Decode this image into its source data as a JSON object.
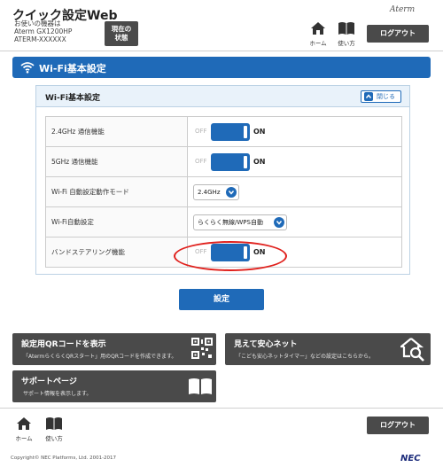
{
  "header": {
    "app_title": "クイック設定Web",
    "device_label": "お使いの機器は",
    "model": "Aterm GX1200HP",
    "serial": "ATERM-XXXXXX",
    "status_button": "現在の状態",
    "home": "ホーム",
    "manual": "使い方",
    "brand": "Aterm",
    "logout": "ログアウト"
  },
  "section": {
    "title": "Wi-Fi基本設定"
  },
  "panel": {
    "title": "Wi-Fi基本設定",
    "close_label": "閉じる",
    "rows": [
      {
        "label": "2.4GHz 通信機能",
        "off": "OFF",
        "on": "ON"
      },
      {
        "label": "5GHz 通信機能",
        "off": "OFF",
        "on": "ON"
      },
      {
        "label": "Wi-Fi 自動設定動作モード",
        "select": "2.4GHz"
      },
      {
        "label": "Wi-Fi自動設定",
        "select": "らくらく無線/WPS自動"
      },
      {
        "label": "バンドステアリング機能",
        "off": "OFF",
        "on": "ON"
      }
    ]
  },
  "apply_button": "設定",
  "cards": {
    "qr": {
      "title": "設定用QRコードを表示",
      "desc": "「AtermらくらくQRスタート」用のQRコードを作成できます。"
    },
    "safe": {
      "title": "見えて安心ネット",
      "desc": "「こども安心ネットタイマー」などの設定はこちらから。"
    },
    "support": {
      "title": "サポートページ",
      "desc": "サポート情報を表示します。"
    }
  },
  "footer": {
    "home": "ホーム",
    "manual": "使い方",
    "logout": "ログアウト",
    "copyright": "Copyright© NEC Platforms, Ltd. 2001-2017",
    "logo": "NEC"
  },
  "colors": {
    "accent": "#1f6ab8",
    "dark_button": "#4a4a4a",
    "highlight": "#e0201c"
  }
}
